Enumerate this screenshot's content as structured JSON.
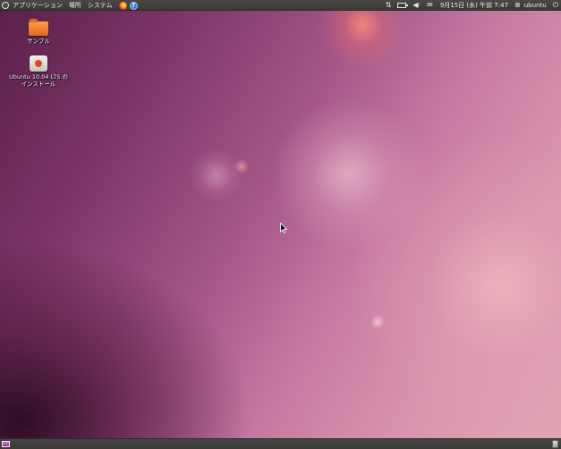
{
  "top_panel": {
    "menus": [
      "アプリケーション",
      "場所",
      "システム"
    ],
    "tray": {
      "clock": "9月15日 (水) 午前 7:47",
      "user": "ubuntu"
    }
  },
  "desktop": {
    "icons": [
      {
        "label_lines": [
          "サンプル"
        ],
        "icon": "folder-icon"
      },
      {
        "label_lines": [
          "Ubuntu 10.04 LTS の",
          "インストール"
        ],
        "icon": "installer-icon"
      }
    ]
  },
  "colors": {
    "panel": "#3c3b37",
    "wallpaper_dark": "#5a1f48",
    "wallpaper_light": "#e3a6b6",
    "folder": "#e8742a"
  }
}
